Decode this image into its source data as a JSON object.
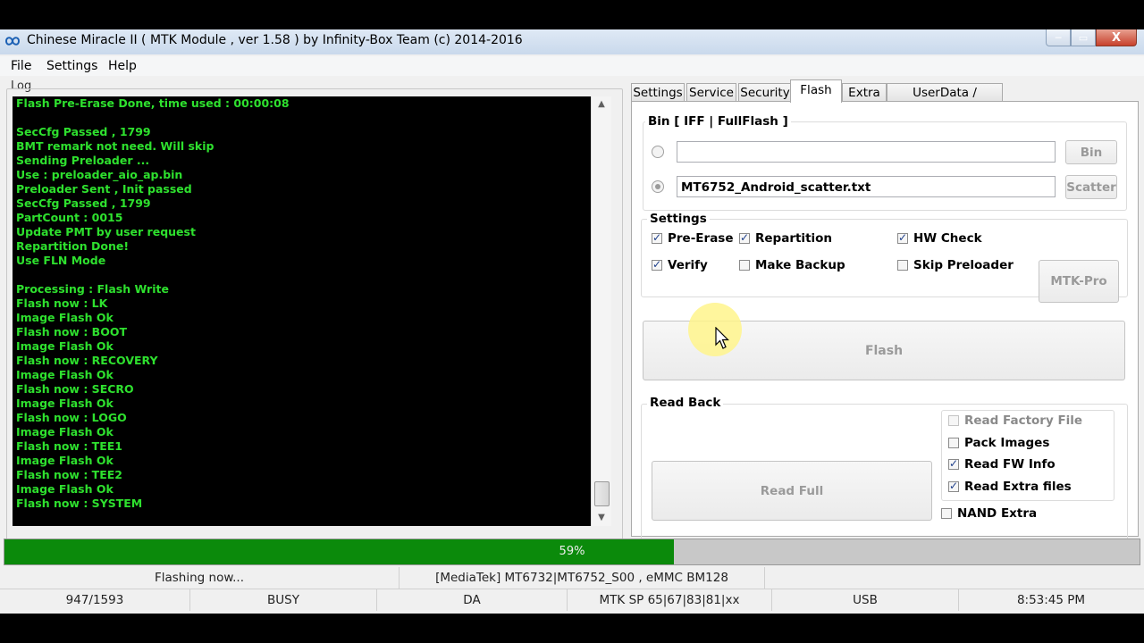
{
  "window": {
    "title": "Chinese Miracle II ( MTK Module , ver 1.58 ) by Infinity-Box Team (c) 2014-2016",
    "controls": {
      "minimize": "─",
      "maximize": "▭",
      "close": "X"
    }
  },
  "menu": {
    "items": [
      "File",
      "Settings",
      "Help"
    ]
  },
  "log": {
    "label": "Log",
    "lines": [
      "Flash Pre-Erase Done, time used : 00:00:08",
      "",
      "SecCfg Passed , 1799",
      "BMT remark not need. Will skip",
      "Sending Preloader ...",
      "Use : preloader_aio_ap.bin",
      "Preloader Sent , Init passed",
      "SecCfg Passed , 1799",
      "PartCount : 0015",
      "Update PMT by user request",
      "Repartition Done!",
      "Use FLN Mode",
      "",
      "Processing : Flash Write",
      "Flash now : LK",
      "Image Flash Ok",
      "Flash now : BOOT",
      "Image Flash Ok",
      "Flash now : RECOVERY",
      "Image Flash Ok",
      "Flash now : SECRO",
      "Image Flash Ok",
      "Flash now : LOGO",
      "Image Flash Ok",
      "Flash now : TEE1",
      "Image Flash Ok",
      "Flash now : TEE2",
      "Image Flash Ok",
      "Flash now : SYSTEM"
    ],
    "color": "#2ee02e"
  },
  "tabs": {
    "items": [
      "Settings",
      "Service",
      "Security",
      "Flash",
      "Extra",
      "UserData / Forensic"
    ],
    "active": "Flash"
  },
  "flash": {
    "bin_group_title": "Bin  [ IFF | FullFlash ]",
    "bin_path": "",
    "scatter_path": "MT6752_Android_scatter.txt",
    "bin_button": "Bin",
    "scatter_button": "Scatter",
    "settings_title": "Settings",
    "options": [
      {
        "label": "Pre-Erase",
        "checked": true
      },
      {
        "label": "Repartition",
        "checked": true
      },
      {
        "label": "HW Check",
        "checked": true
      },
      {
        "label": "Verify",
        "checked": true
      },
      {
        "label": "Make Backup",
        "checked": false
      },
      {
        "label": "Skip Preloader",
        "checked": false
      }
    ],
    "mtk_pro_button": "MTK-Pro",
    "flash_button": "Flash",
    "readback_title": "Read Back",
    "read_full_button": "Read Full",
    "readback_options": [
      {
        "label": "Read Factory File",
        "checked": false,
        "disabled": true
      },
      {
        "label": "Pack Images",
        "checked": false,
        "disabled": false
      },
      {
        "label": "Read FW Info",
        "checked": true,
        "disabled": false
      },
      {
        "label": "Read Extra files",
        "checked": true,
        "disabled": false
      }
    ],
    "nand_extra": {
      "label": "NAND Extra",
      "checked": false
    }
  },
  "progress": {
    "percent": 59,
    "label": "59%",
    "fill_color": "#0b8a0b"
  },
  "status": {
    "message": "Flashing now...",
    "device": "[MediaTek] MT6732|MT6752_S00 , eMMC BM128",
    "count": "947/1593",
    "state": "BUSY",
    "mode": "DA",
    "version": "MTK SP 65|67|83|81|xx",
    "connection": "USB",
    "time": "8:53:45 PM"
  }
}
